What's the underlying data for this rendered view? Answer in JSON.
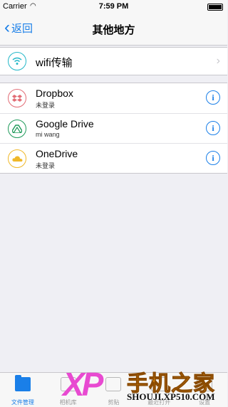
{
  "status_bar": {
    "carrier": "Carrier",
    "wifi_icon": "wifi-icon",
    "time": "7:59 PM",
    "battery_icon": "battery-icon"
  },
  "nav": {
    "back_label": "返回",
    "title": "其他地方"
  },
  "group1": {
    "items": [
      {
        "label": "wifi传输",
        "icon": "wifi-icon"
      }
    ]
  },
  "group2": {
    "items": [
      {
        "label": "Dropbox",
        "sub": "未登录",
        "icon": "dropbox-icon",
        "accent": "#e26d76"
      },
      {
        "label": "Google Drive",
        "sub": "mi wang",
        "icon": "google-drive-icon",
        "accent": "#1f9a5a"
      },
      {
        "label": "OneDrive",
        "sub": "未登录",
        "icon": "onedrive-icon",
        "accent": "#f0b829"
      }
    ]
  },
  "tabs": [
    {
      "label": "文件管理",
      "icon": "folder-icon",
      "active": true
    },
    {
      "label": "相机库",
      "icon": "camera-icon"
    },
    {
      "label": "剪贴",
      "icon": "clip-icon"
    },
    {
      "label": "最近打开",
      "icon": "clock-icon"
    },
    {
      "label": "设置",
      "icon": "gear-icon"
    }
  ],
  "watermark": {
    "logo": "XP",
    "brand": "手机之家",
    "url": "SHOUJI.XP510.COM"
  },
  "colors": {
    "accent": "#1a7fe8",
    "background": "#efeff4"
  }
}
